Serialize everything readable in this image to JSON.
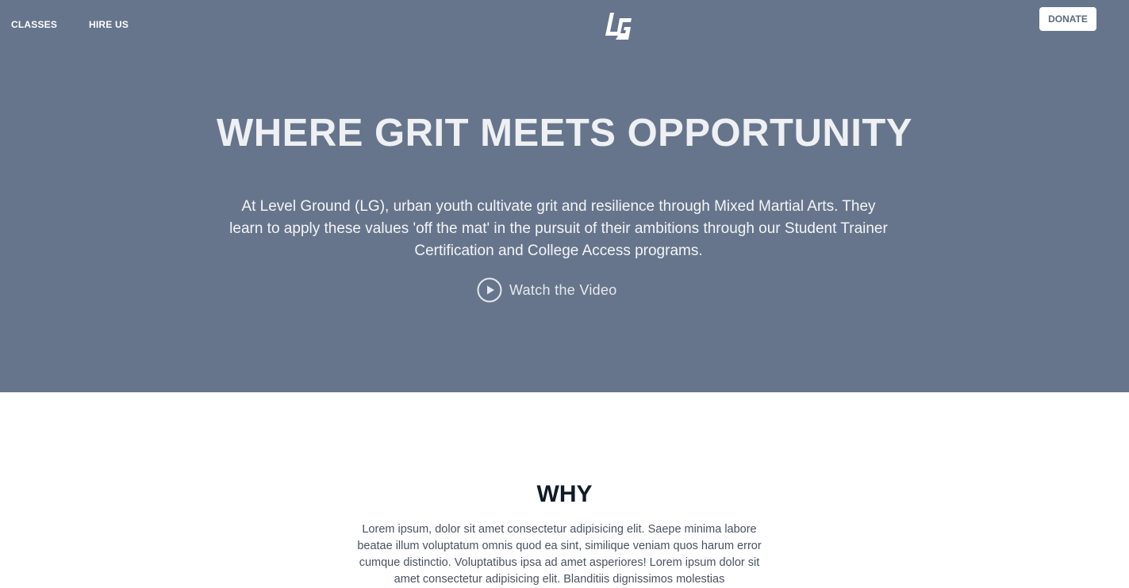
{
  "nav": {
    "classes_label": "CLASSES",
    "hire_label": "HIRE US",
    "logo_icon": "lg-logo-icon",
    "donate_label": "DONATE"
  },
  "hero": {
    "title": "WHERE GRIT MEETS OPPORTUNITY",
    "description": "At Level Ground (LG), urban youth cultivate grit and resilience through Mixed Martial Arts. They learn to apply these values 'off the mat' in the pursuit of their ambitions through our Student Trainer Certification and College Access programs.",
    "watch_icon": "play-circle-icon",
    "watch_label": "Watch the Video"
  },
  "why": {
    "title": "WHY",
    "text": "Lorem ipsum, dolor sit amet consectetur adipisicing elit. Saepe minima labore beatae illum voluptatum omnis quod ea sint, similique veniam quos harum error cumque distinctio. Voluptatibus ipsa ad amet asperiores! Lorem ipsum dolor sit amet consectetur adipisicing elit. Blanditiis dignissimos molestias"
  },
  "colors": {
    "hero_background": "#66758c",
    "donate_background": "#ffffff",
    "donate_text": "#5b6b82",
    "why_heading": "#111a26"
  }
}
